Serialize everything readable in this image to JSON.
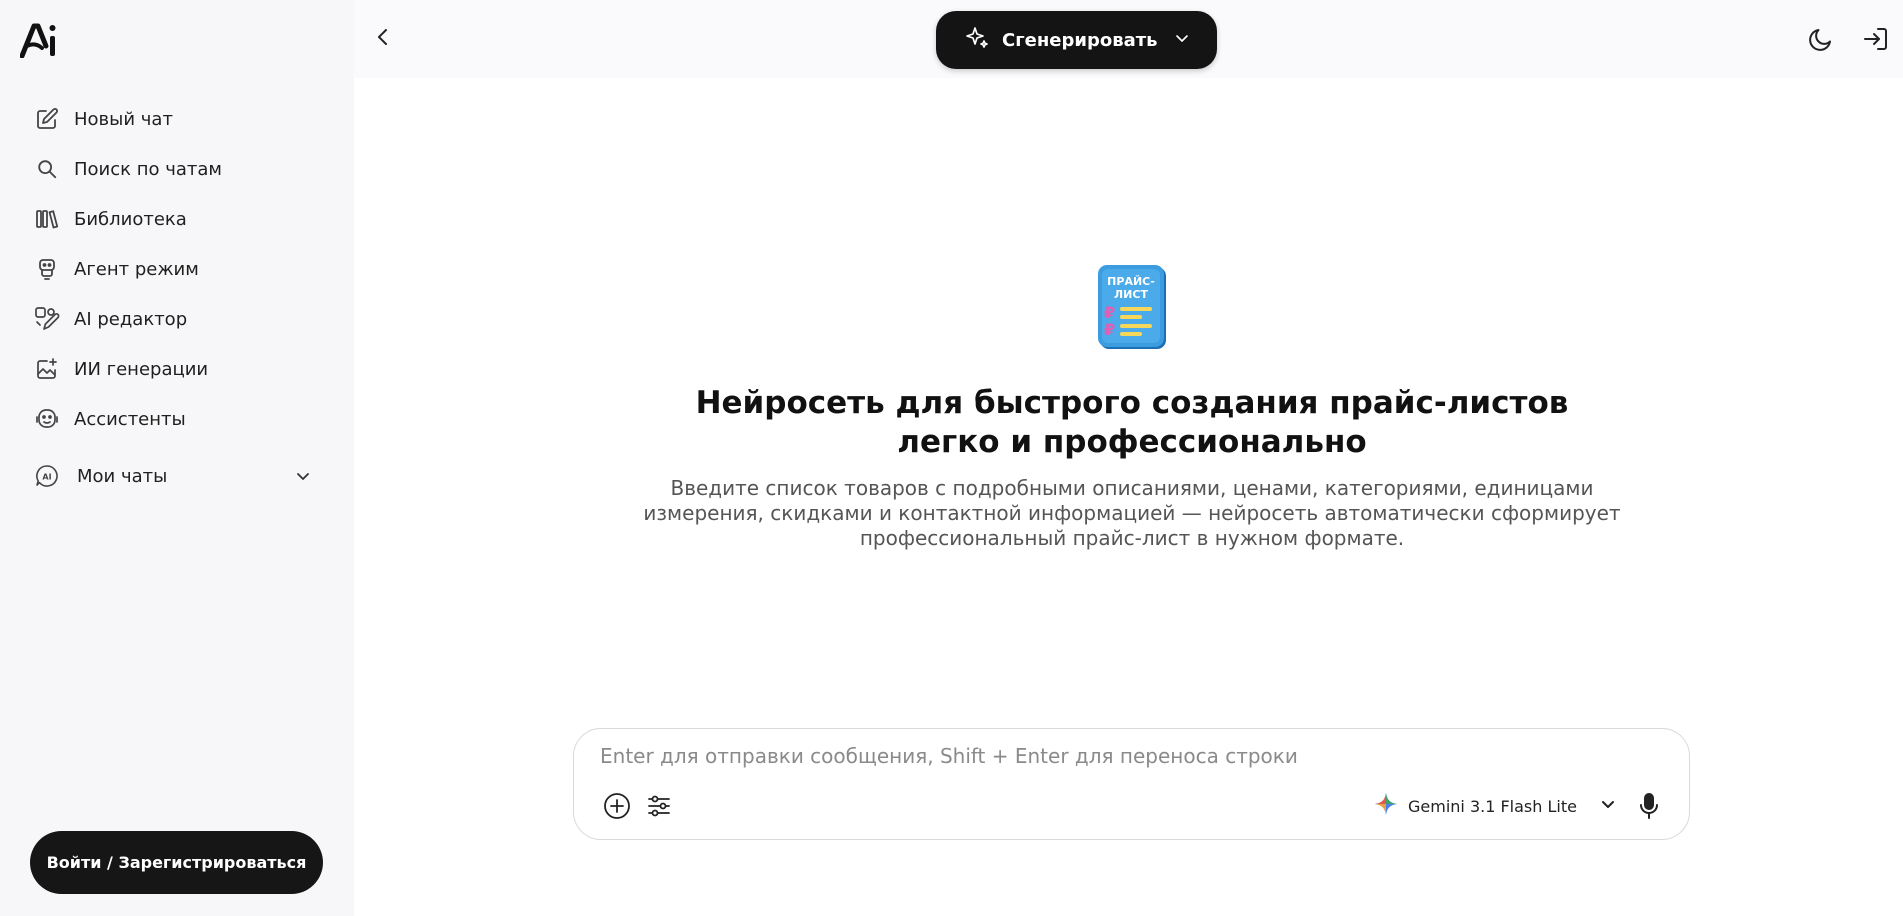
{
  "sidebar": {
    "logo_text": "Ai",
    "items": [
      {
        "label": "Новый чат",
        "icon": "edit-icon"
      },
      {
        "label": "Поиск по чатам",
        "icon": "search-icon"
      },
      {
        "label": "Библиотека",
        "icon": "library-icon"
      },
      {
        "label": "Агент режим",
        "icon": "robot-icon"
      },
      {
        "label": "AI редактор",
        "icon": "ai-editor-icon"
      },
      {
        "label": "ИИ генерации",
        "icon": "image-sparkle-icon"
      },
      {
        "label": "Ассистенты",
        "icon": "assistant-face-icon"
      }
    ],
    "my_chats_label": "Мои чаты",
    "login_label": "Войти / Зарегистрироваться"
  },
  "header": {
    "generate_label": "Сгенерировать"
  },
  "hero": {
    "icon_text_line1": "ПРАЙС-",
    "icon_text_line2": "ЛИСТ",
    "title": "Нейросеть для быстрого создания прайс-листов легко и профессионально",
    "description": "Введите список товаров с подробными описаниями, ценами, категориями, единицами измерения, скидками и контактной информацией — нейросеть автоматически сформирует профессиональный прайс-лист в нужном формате."
  },
  "composer": {
    "placeholder": "Enter для отправки сообщения, Shift + Enter для переноса строки",
    "value": "",
    "model_name": "Gemini 3.1 Flash Lite"
  }
}
